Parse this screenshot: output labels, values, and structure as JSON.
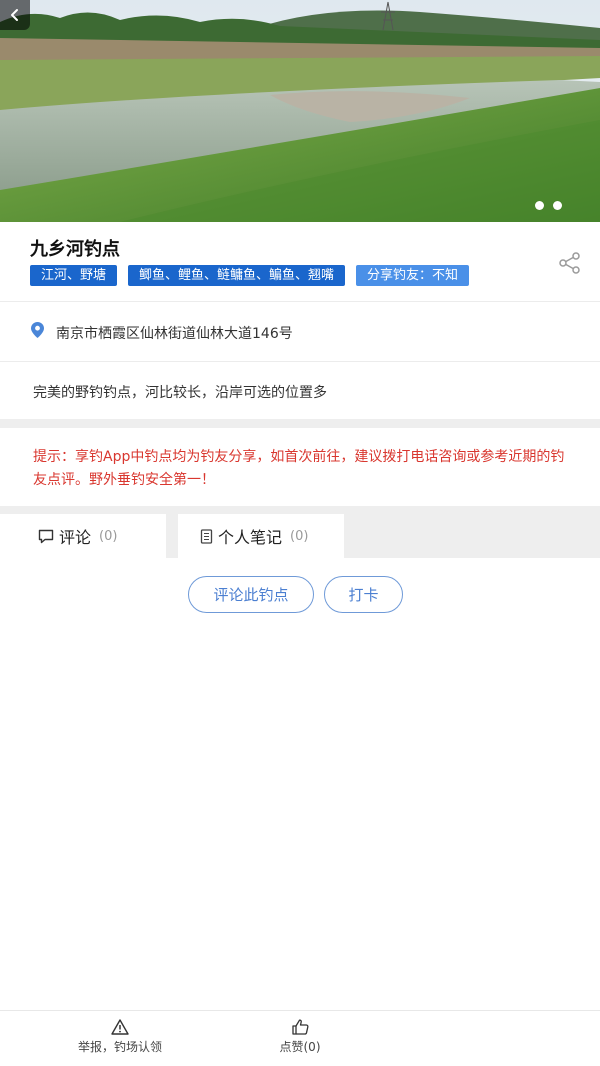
{
  "hero": {
    "image_alt": "river fishing spot photo",
    "slide_count": 2
  },
  "spot": {
    "title": "九乡河钓点",
    "tags": [
      "江河、野塘",
      "鲫鱼、鲤鱼、鲢鳙鱼、鳊鱼、翘嘴",
      "分享钓友：不知"
    ]
  },
  "address": {
    "icon": "location-pin-icon",
    "text": "南京市栖霞区仙林街道仙林大道146号"
  },
  "description": "完美的野钓钓点，河比较长，沿岸可选的位置多",
  "notice": "提示：享钓App中钓点均为钓友分享，如首次前往，建议拨打电话咨询或参考近期的钓友点评。野外垂钓安全第一！",
  "tabs": [
    {
      "label": "评论",
      "count": "(0)",
      "icon": "comment-icon"
    },
    {
      "label": "个人笔记",
      "count": "(0)",
      "icon": "notebook-icon"
    }
  ],
  "actions": {
    "comment_label": "评论此钓点",
    "checkin_label": "打卡"
  },
  "bottom": {
    "report_label": "举报，钓场认领",
    "like_label": "点赞(0)"
  },
  "colors": {
    "tag_blue": "#1a66cc",
    "share_tag_blue": "#4a90e8",
    "notice_red": "#d9372f",
    "button_border": "#6f9ad8"
  }
}
